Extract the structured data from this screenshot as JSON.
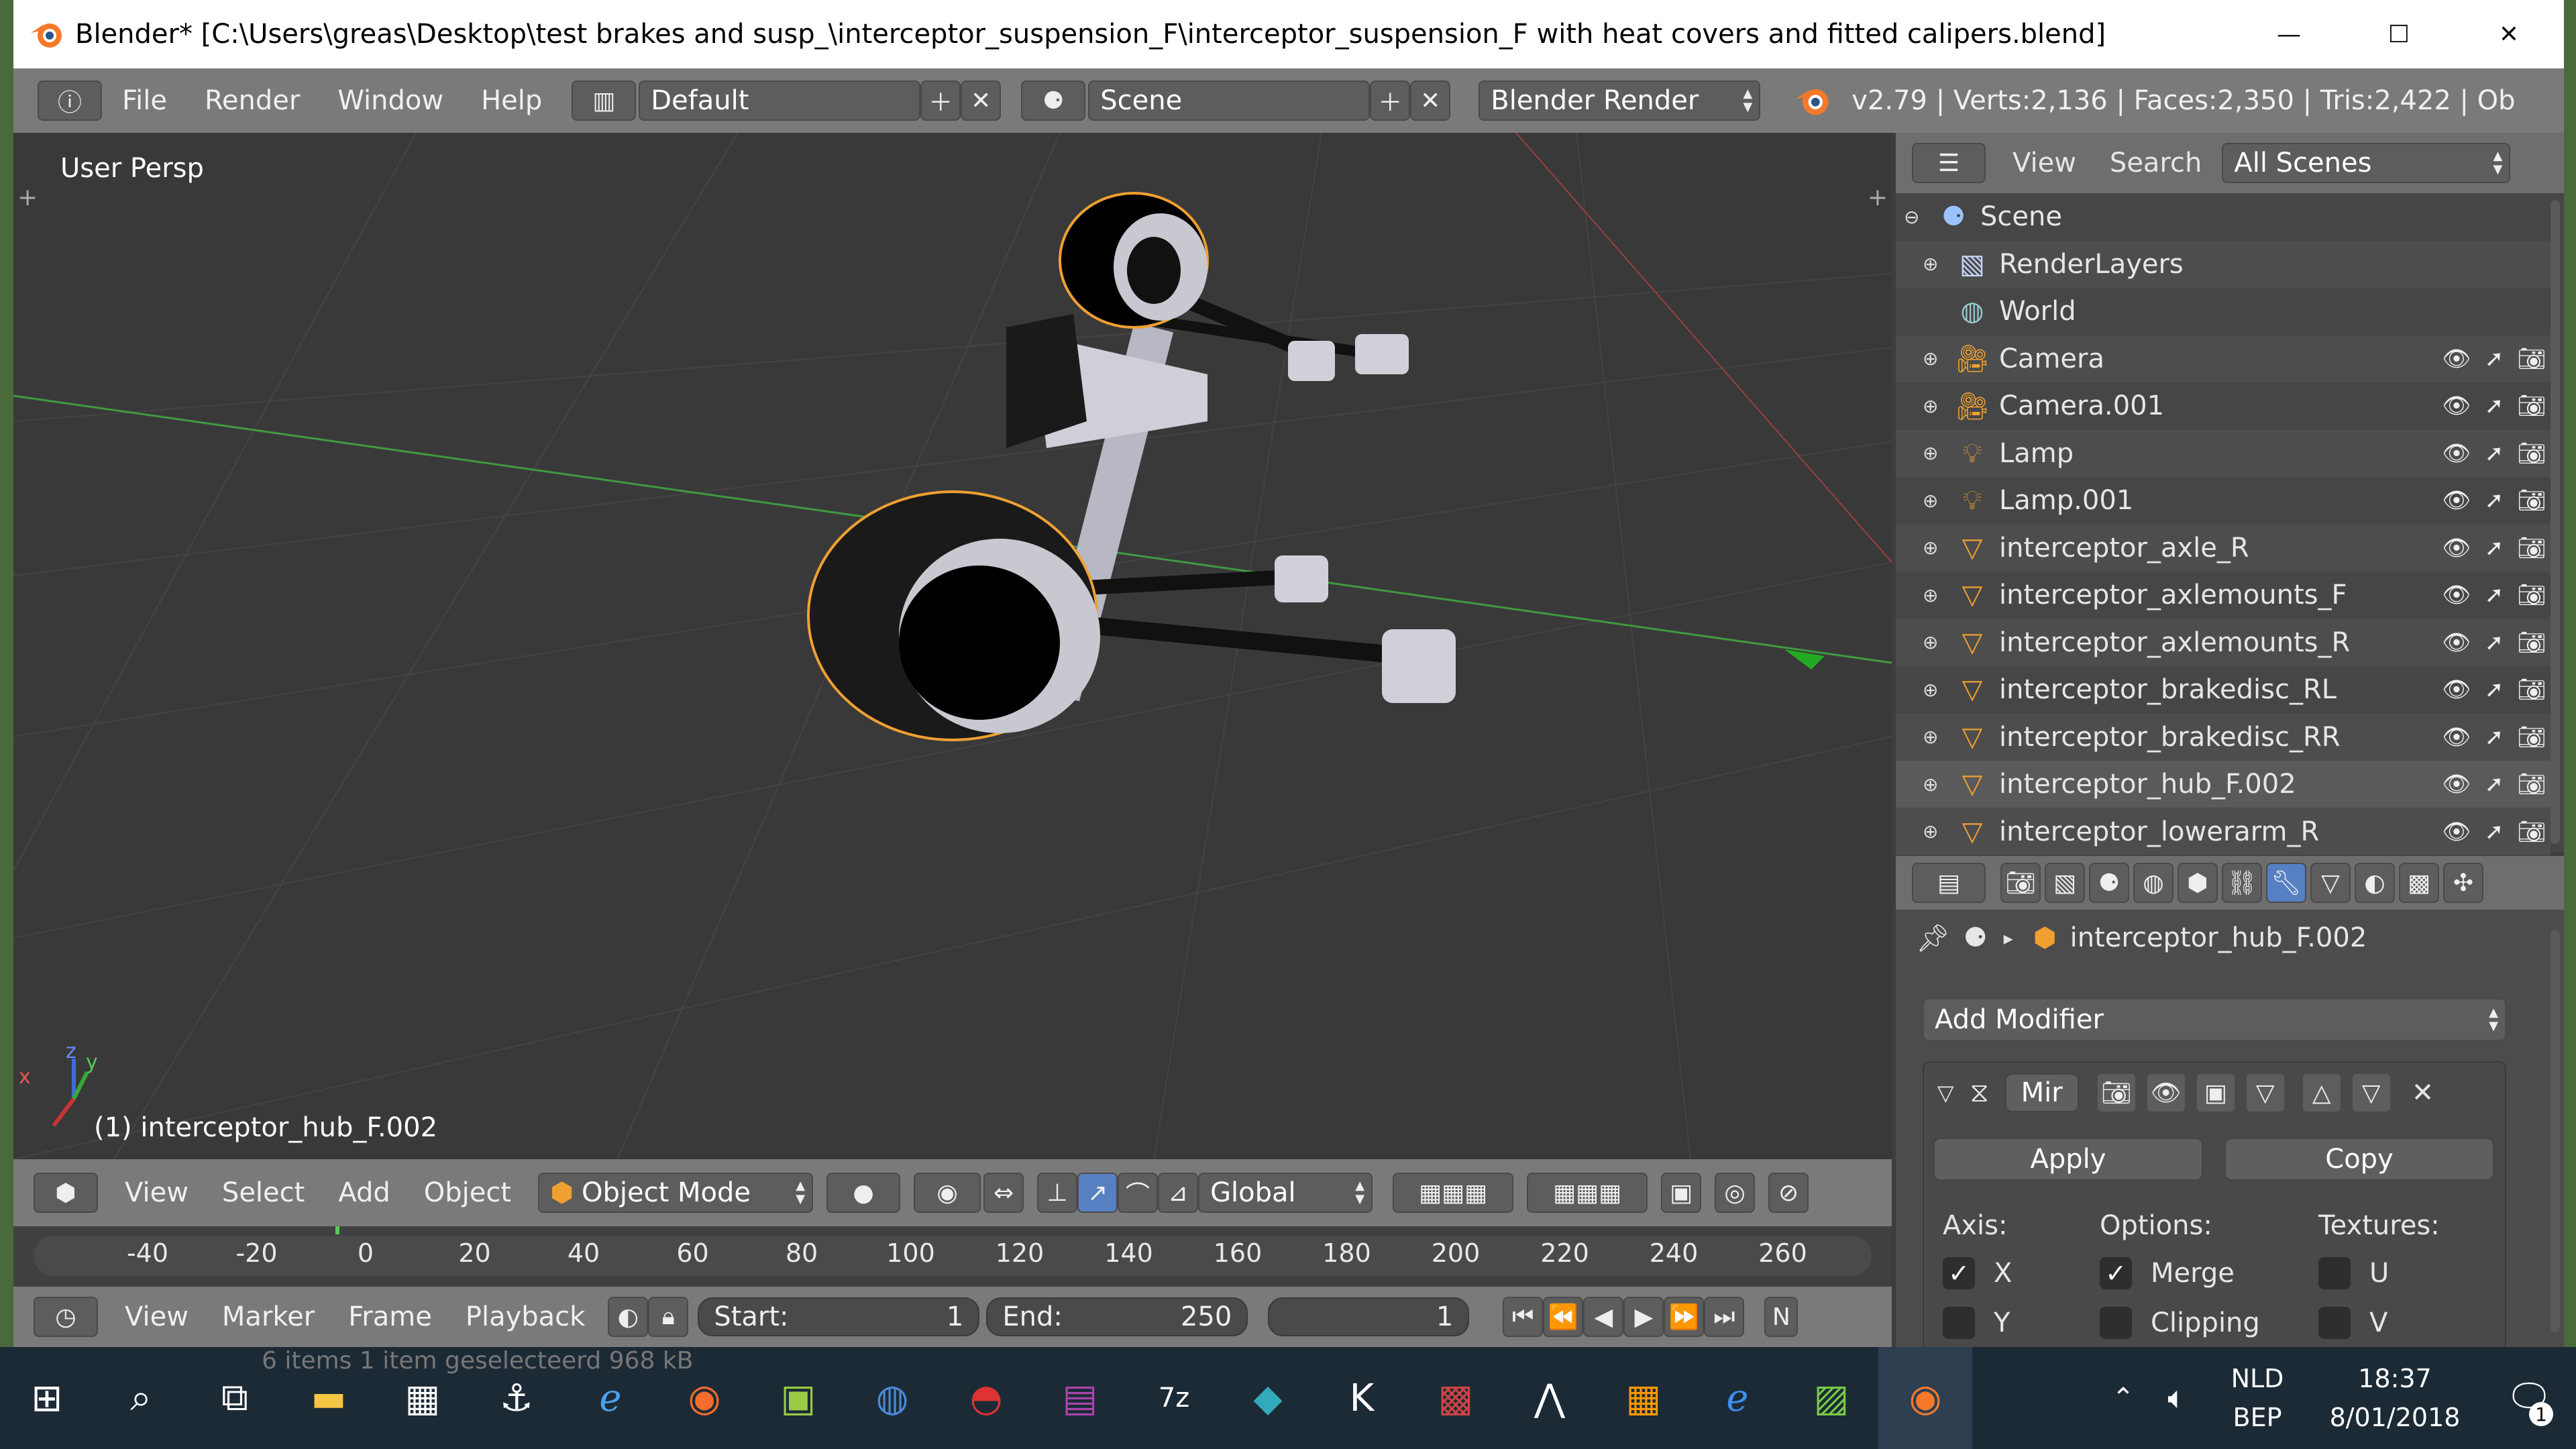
{
  "window": {
    "title": "Blender* [C:\\Users\\greas\\Desktop\\test brakes and susp_\\interceptor_suspension_F\\interceptor_suspension_F with  heat covers and fitted calipers.blend]",
    "minimize": "—",
    "maximize": "☐",
    "close": "✕"
  },
  "topbar": {
    "menus": [
      "File",
      "Render",
      "Window",
      "Help"
    ],
    "layout": "Default",
    "scene": "Scene",
    "engine": "Blender Render",
    "stats": "v2.79 | Verts:2,136 | Faces:2,350 | Tris:2,422 | Ob"
  },
  "viewport": {
    "view_label": "User Persp",
    "active_object": "(1) interceptor_hub_F.002",
    "axis_x": "x",
    "axis_y": "y",
    "axis_z": "z"
  },
  "view3d_header": {
    "menus": [
      "View",
      "Select",
      "Add",
      "Object"
    ],
    "mode": "Object Mode",
    "orientation": "Global"
  },
  "timeline": {
    "ticks": [
      "-40",
      "-20",
      "0",
      "20",
      "40",
      "60",
      "80",
      "100",
      "120",
      "140",
      "160",
      "180",
      "200",
      "220",
      "240",
      "260"
    ],
    "menus": [
      "View",
      "Marker",
      "Frame",
      "Playback"
    ],
    "start_label": "Start:",
    "start_value": "1",
    "end_label": "End:",
    "end_value": "250",
    "current_frame": "1",
    "trailing": "N"
  },
  "outliner": {
    "menus": [
      "View",
      "Search"
    ],
    "filter": "All Scenes",
    "items": [
      {
        "label": "Scene",
        "icon": "scene-icon",
        "indent": 0
      },
      {
        "label": "RenderLayers",
        "icon": "renderlayers-icon",
        "indent": 1
      },
      {
        "label": "World",
        "icon": "world-icon",
        "indent": 1
      },
      {
        "label": "Camera",
        "icon": "camera-icon",
        "indent": 1
      },
      {
        "label": "Camera.001",
        "icon": "camera-icon",
        "indent": 1
      },
      {
        "label": "Lamp",
        "icon": "lamp-icon",
        "indent": 1
      },
      {
        "label": "Lamp.001",
        "icon": "lamp-icon",
        "indent": 1
      },
      {
        "label": "interceptor_axle_R",
        "icon": "mesh-icon",
        "indent": 1
      },
      {
        "label": "interceptor_axlemounts_F",
        "icon": "mesh-icon",
        "indent": 1
      },
      {
        "label": "interceptor_axlemounts_R",
        "icon": "mesh-icon",
        "indent": 1
      },
      {
        "label": "interceptor_brakedisc_RL",
        "icon": "mesh-icon",
        "indent": 1
      },
      {
        "label": "interceptor_brakedisc_RR",
        "icon": "mesh-icon",
        "indent": 1
      },
      {
        "label": "interceptor_hub_F.002",
        "icon": "mesh-icon",
        "indent": 1
      },
      {
        "label": "interceptor_lowerarm_R",
        "icon": "mesh-icon",
        "indent": 1
      }
    ]
  },
  "properties": {
    "object_name": "interceptor_hub_F.002",
    "add_modifier": "Add Modifier",
    "modifier_name": "Mir",
    "apply": "Apply",
    "copy": "Copy",
    "axis_label": "Axis:",
    "options_label": "Options:",
    "textures_label": "Textures:",
    "axis_x": "X",
    "axis_y": "Y",
    "merge": "Merge",
    "clipping": "Clipping",
    "tex_u": "U",
    "tex_v": "V"
  },
  "taskbar": {
    "lang1": "NLD",
    "lang2": "BEP",
    "time": "18:37",
    "date": "8/01/2018",
    "notif_count": "1",
    "bg_text": "6 items     1 item geselecteerd  968 kB"
  },
  "colors": {
    "accent_blue": "#5680c2",
    "selection_orange": "#f0a030",
    "viewport_bg": "#393939",
    "header_gray": "#7a7a7a"
  }
}
